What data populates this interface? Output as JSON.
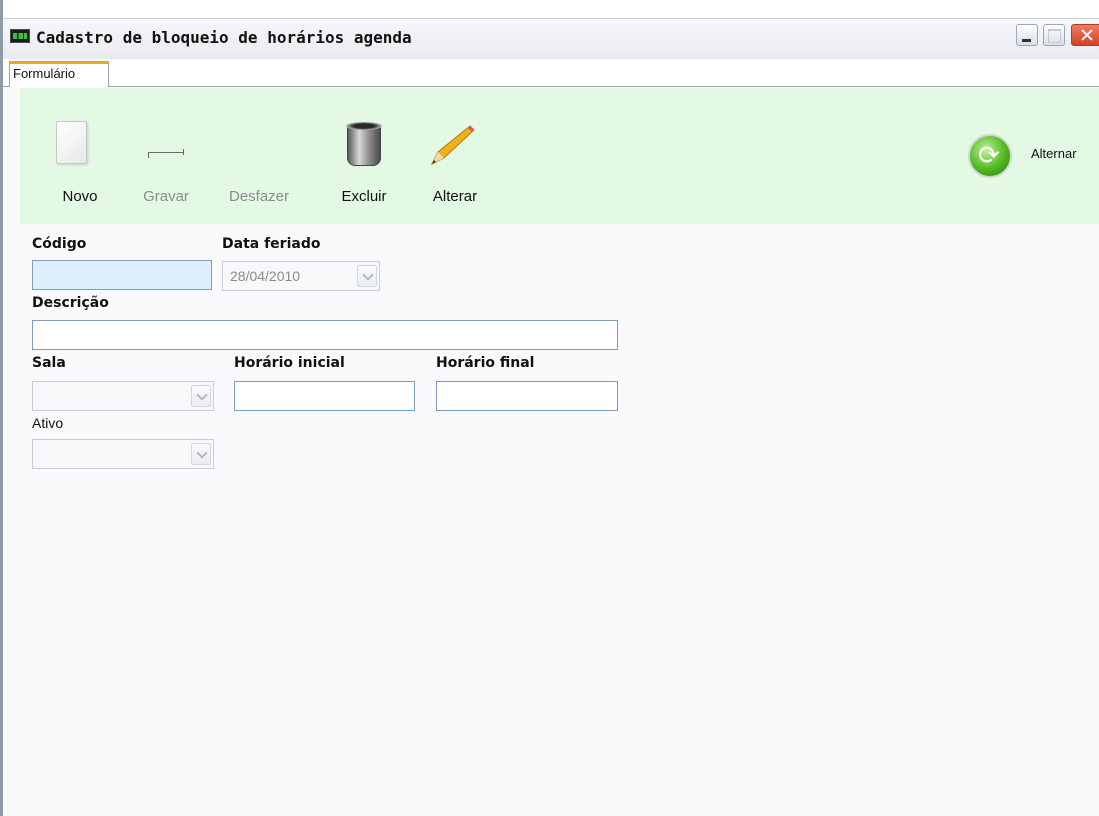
{
  "window": {
    "title": "Cadastro de bloqueio de horários agenda",
    "tab_label": "Formulário"
  },
  "toolbar": {
    "novo": "Novo",
    "gravar": "Gravar",
    "desfazer": "Desfazer",
    "excluir": "Excluir",
    "alterar": "Alterar",
    "alternar": "Alternar",
    "background_color": "#e4f9e4"
  },
  "form": {
    "codigo_label": "Código",
    "codigo_value": "",
    "data_feriado_label": "Data feriado",
    "data_feriado_value": "28/04/2010",
    "descricao_label": "Descrição",
    "descricao_value": "",
    "sala_label": "Sala",
    "sala_value": "",
    "horario_inicial_label": "Horário inicial",
    "horario_inicial_value": "",
    "horario_final_label": "Horário final",
    "horario_final_value": "",
    "ativo_label": "Ativo",
    "ativo_value": ""
  },
  "icons": {
    "app": "app-monitor-icon",
    "novo": "new-document-icon",
    "gravar": "save-icon",
    "excluir": "trash-bin-icon",
    "alterar": "pencil-icon",
    "alternar": "refresh-icon"
  }
}
